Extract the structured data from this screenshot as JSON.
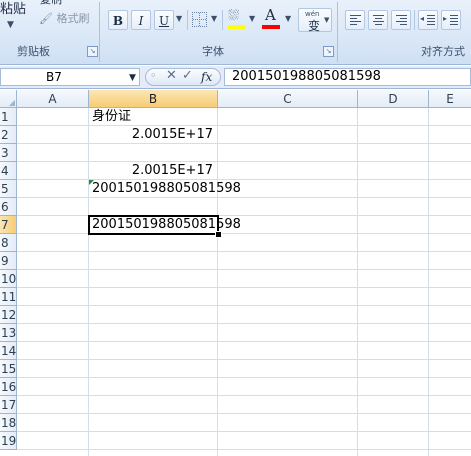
{
  "ribbon": {
    "clipboard": {
      "paste_label": "粘贴",
      "copy_label": "复制",
      "format_painter_label": "格式刷",
      "group_label": "剪贴板"
    },
    "font": {
      "bold_label": "B",
      "italic_label": "I",
      "underline_label": "U",
      "group_label": "字体",
      "phonetic_label": "wén",
      "phonetic_char": "变",
      "fill_color": "#ffff00",
      "font_color": "#ff0000"
    },
    "alignment": {
      "group_label": "对齐方式"
    }
  },
  "formula_bar": {
    "name_box": "B7",
    "fx_label": "fx",
    "value": "200150198805081598"
  },
  "grid": {
    "columns": [
      "A",
      "B",
      "C",
      "D",
      "E"
    ],
    "selected_column": "B",
    "rows": [
      "1",
      "2",
      "3",
      "4",
      "5",
      "6",
      "7",
      "8",
      "9",
      "10",
      "11",
      "12",
      "13",
      "14",
      "15",
      "16",
      "17",
      "18",
      "19"
    ],
    "selected_row": "7",
    "cells": {
      "B1": "身份证",
      "B2": "2.0015E+17",
      "B4": "2.0015E+17",
      "B5": "200150198805081598",
      "B7": "200150198805081598"
    }
  },
  "colors": {
    "accent_selection": "#f8cc73",
    "ribbon": "#dbe8f7",
    "error_indicator": "#1f8a3b"
  }
}
